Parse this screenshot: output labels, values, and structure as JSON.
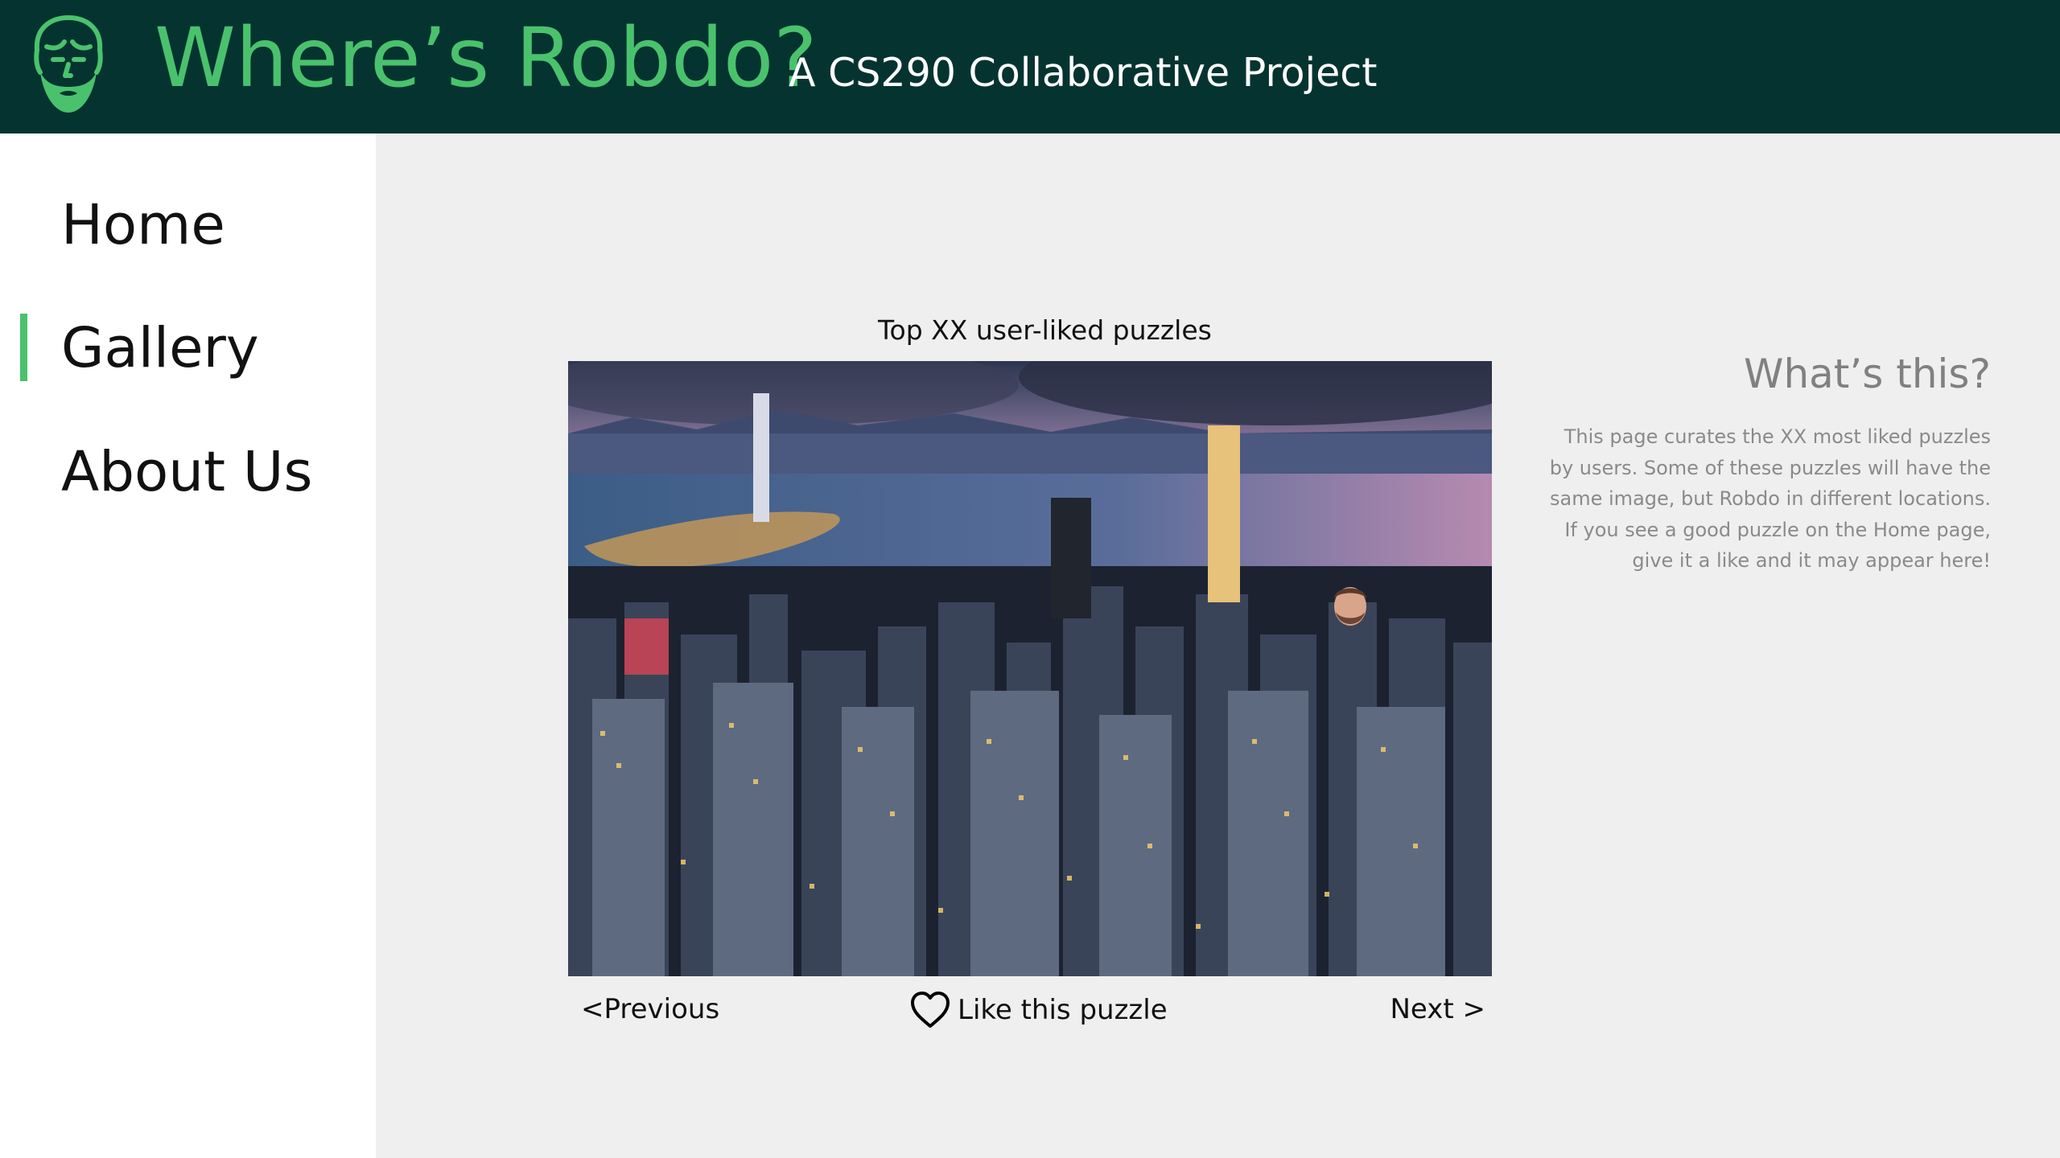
{
  "header": {
    "title": "Where’s Robdo?",
    "subtitle": "A CS290 Collaborative Project",
    "logo_icon": "bearded-face-icon",
    "background_color": "#053430",
    "accent_color": "#4ac26d"
  },
  "sidebar": {
    "items": [
      {
        "label": "Home",
        "active": false
      },
      {
        "label": "Gallery",
        "active": true
      },
      {
        "label": "About Us",
        "active": false
      }
    ]
  },
  "gallery": {
    "heading": "Top XX user-liked puzzles",
    "image_description": "Night city skyline with Robdo's face hidden among buildings",
    "previous_label": "<Previous",
    "like_label": "Like this puzzle",
    "like_icon": "heart-outline-icon",
    "next_label": "Next >"
  },
  "info": {
    "title": "What’s this?",
    "lines": [
      "This page curates the XX most liked puzzles",
      "by users. Some of these puzzles will have the",
      "same image, but Robdo in different locations.",
      "If you see a good puzzle on the Home page,",
      "give it a like and it may appear here!"
    ]
  }
}
